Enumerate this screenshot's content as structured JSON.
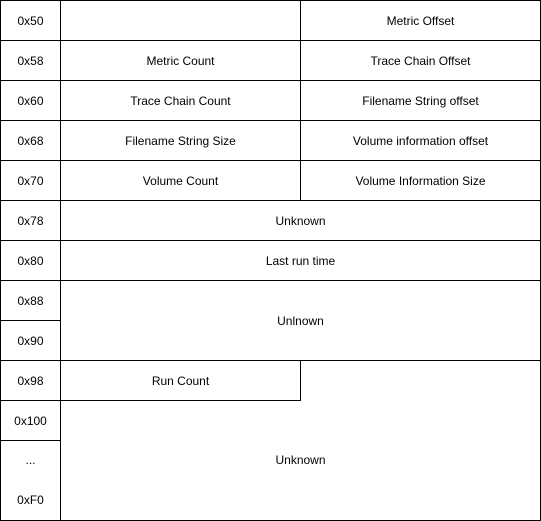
{
  "diagram": {
    "title": "",
    "offsets": {
      "o50": "0x50",
      "o58": "0x58",
      "o60": "0x60",
      "o68": "0x68",
      "o70": "0x70",
      "o78": "0x78",
      "o80": "0x80",
      "o88": "0x88",
      "o90": "0x90",
      "o98": "0x98",
      "o100": "0x100",
      "ellipsis": "...",
      "oF0": "0xF0"
    },
    "fields": {
      "metric_offset": "Metric Offset",
      "metric_count": "Metric Count",
      "trace_chain_offset": "Trace Chain Offset",
      "trace_chain_count": "Trace Chain Count",
      "filename_string_offset": "Filename String offset",
      "filename_string_size": "Filename String Size",
      "volume_information_offset": "Volume information offset",
      "volume_count": "Volume Count",
      "volume_information_size": "Volume Information Size",
      "unknown_78": "Unknown",
      "last_run_time": "Last run time",
      "unknown_88": "Unlnown",
      "run_count": "Run Count",
      "unknown_tail": "Unknown"
    }
  }
}
